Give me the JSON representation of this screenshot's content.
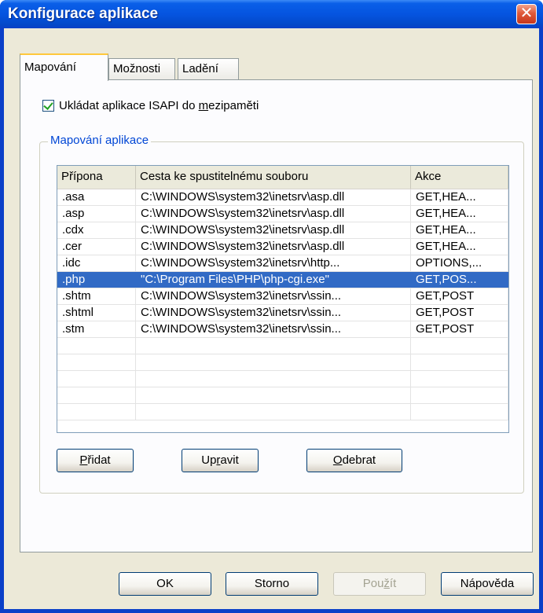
{
  "window": {
    "title": "Konfigurace aplikace",
    "close_glyph": "✕"
  },
  "tabs": [
    {
      "label": "Mapování",
      "active": true
    },
    {
      "label": "Možnosti",
      "active": false
    },
    {
      "label": "Ladění",
      "active": false
    }
  ],
  "cache_checkbox": {
    "label_before": "Ukládat aplikace ISAPI do ",
    "label_mnemonic": "m",
    "label_after": "ezipaměti",
    "checked": true
  },
  "mapping_group": {
    "legend": "Mapování aplikace",
    "columns": [
      "Přípona",
      "Cesta ke spustitelnému souboru",
      "Akce"
    ],
    "rows": [
      {
        "ext": ".asa",
        "path": "C:\\WINDOWS\\system32\\inetsrv\\asp.dll",
        "actions": "GET,HEA..."
      },
      {
        "ext": ".asp",
        "path": "C:\\WINDOWS\\system32\\inetsrv\\asp.dll",
        "actions": "GET,HEA..."
      },
      {
        "ext": ".cdx",
        "path": "C:\\WINDOWS\\system32\\inetsrv\\asp.dll",
        "actions": "GET,HEA..."
      },
      {
        "ext": ".cer",
        "path": "C:\\WINDOWS\\system32\\inetsrv\\asp.dll",
        "actions": "GET,HEA..."
      },
      {
        "ext": ".idc",
        "path": "C:\\WINDOWS\\system32\\inetsrv\\http...",
        "actions": "OPTIONS,..."
      },
      {
        "ext": ".php",
        "path": "\"C:\\Program Files\\PHP\\php-cgi.exe\"",
        "actions": "GET,POS...",
        "selected": true
      },
      {
        "ext": ".shtm",
        "path": "C:\\WINDOWS\\system32\\inetsrv\\ssin...",
        "actions": "GET,POST"
      },
      {
        "ext": ".shtml",
        "path": "C:\\WINDOWS\\system32\\inetsrv\\ssin...",
        "actions": "GET,POST"
      },
      {
        "ext": ".stm",
        "path": "C:\\WINDOWS\\system32\\inetsrv\\ssin...",
        "actions": "GET,POST"
      }
    ],
    "empty_rows": 5,
    "buttons": {
      "add": {
        "mnemonic": "P",
        "rest": "řidat"
      },
      "edit": {
        "before": "Up",
        "mnemonic": "r",
        "rest": "avit"
      },
      "remove": {
        "mnemonic": "O",
        "rest": "debrat"
      }
    }
  },
  "footer": {
    "ok": "OK",
    "cancel": "Storno",
    "apply": {
      "before": "Pou",
      "mnemonic": "ž",
      "rest": "ít",
      "enabled": false
    },
    "help": "Nápověda"
  }
}
